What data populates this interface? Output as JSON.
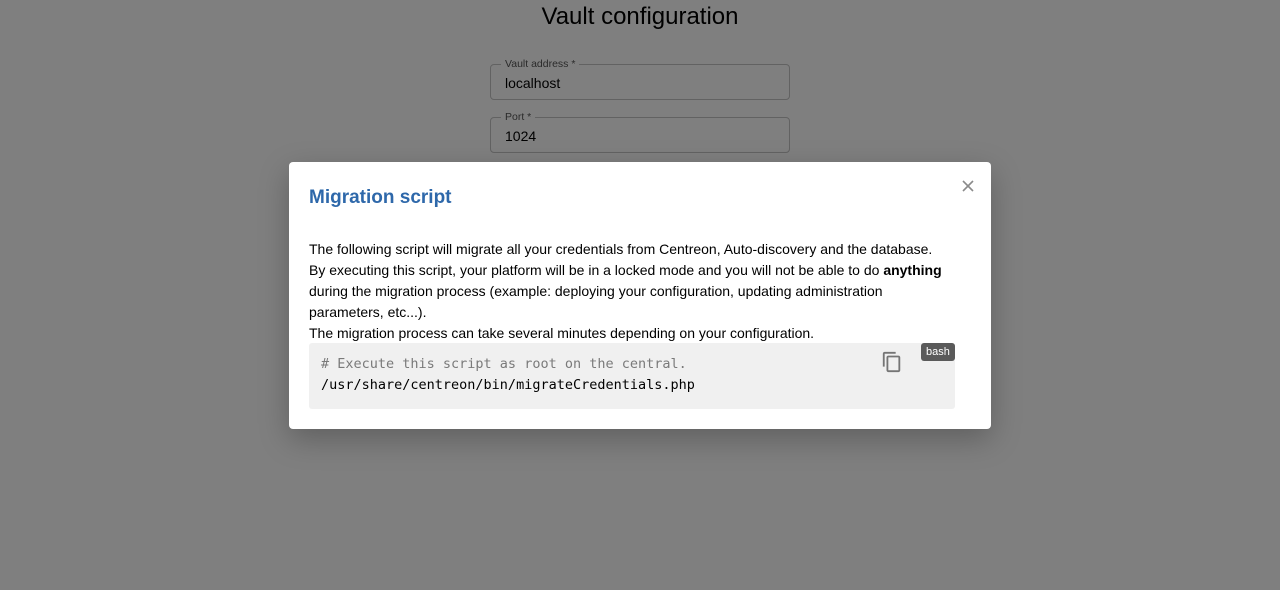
{
  "page": {
    "title": "Vault configuration",
    "fields": {
      "address": {
        "label": "Vault address *",
        "value": "localhost"
      },
      "port": {
        "label": "Port *",
        "value": "1024"
      }
    }
  },
  "dialog": {
    "title": "Migration script",
    "close_icon": "close-icon",
    "paragraph1": "The following script will migrate all your credentials from Centreon, Auto-discovery and the database.",
    "paragraph2_pre": "By executing this script, your platform will be in a locked mode and you will not be able to do ",
    "paragraph2_bold": "anything",
    "paragraph2_post": " during the migration process (example: deploying your configuration, updating administration parameters, etc...).",
    "paragraph3": "The migration process can take several minutes depending on your configuration.",
    "code": {
      "comment": "# Execute this script as root on the central.",
      "command": "/usr/share/centreon/bin/migrateCredentials.php",
      "language": "bash",
      "copy_icon": "copy-icon"
    }
  },
  "colors": {
    "title_blue": "#2e68aa",
    "backdrop": "rgba(0,0,0,0.5)",
    "code_background": "#f0f0f0",
    "badge_background": "#5a5a5a"
  }
}
